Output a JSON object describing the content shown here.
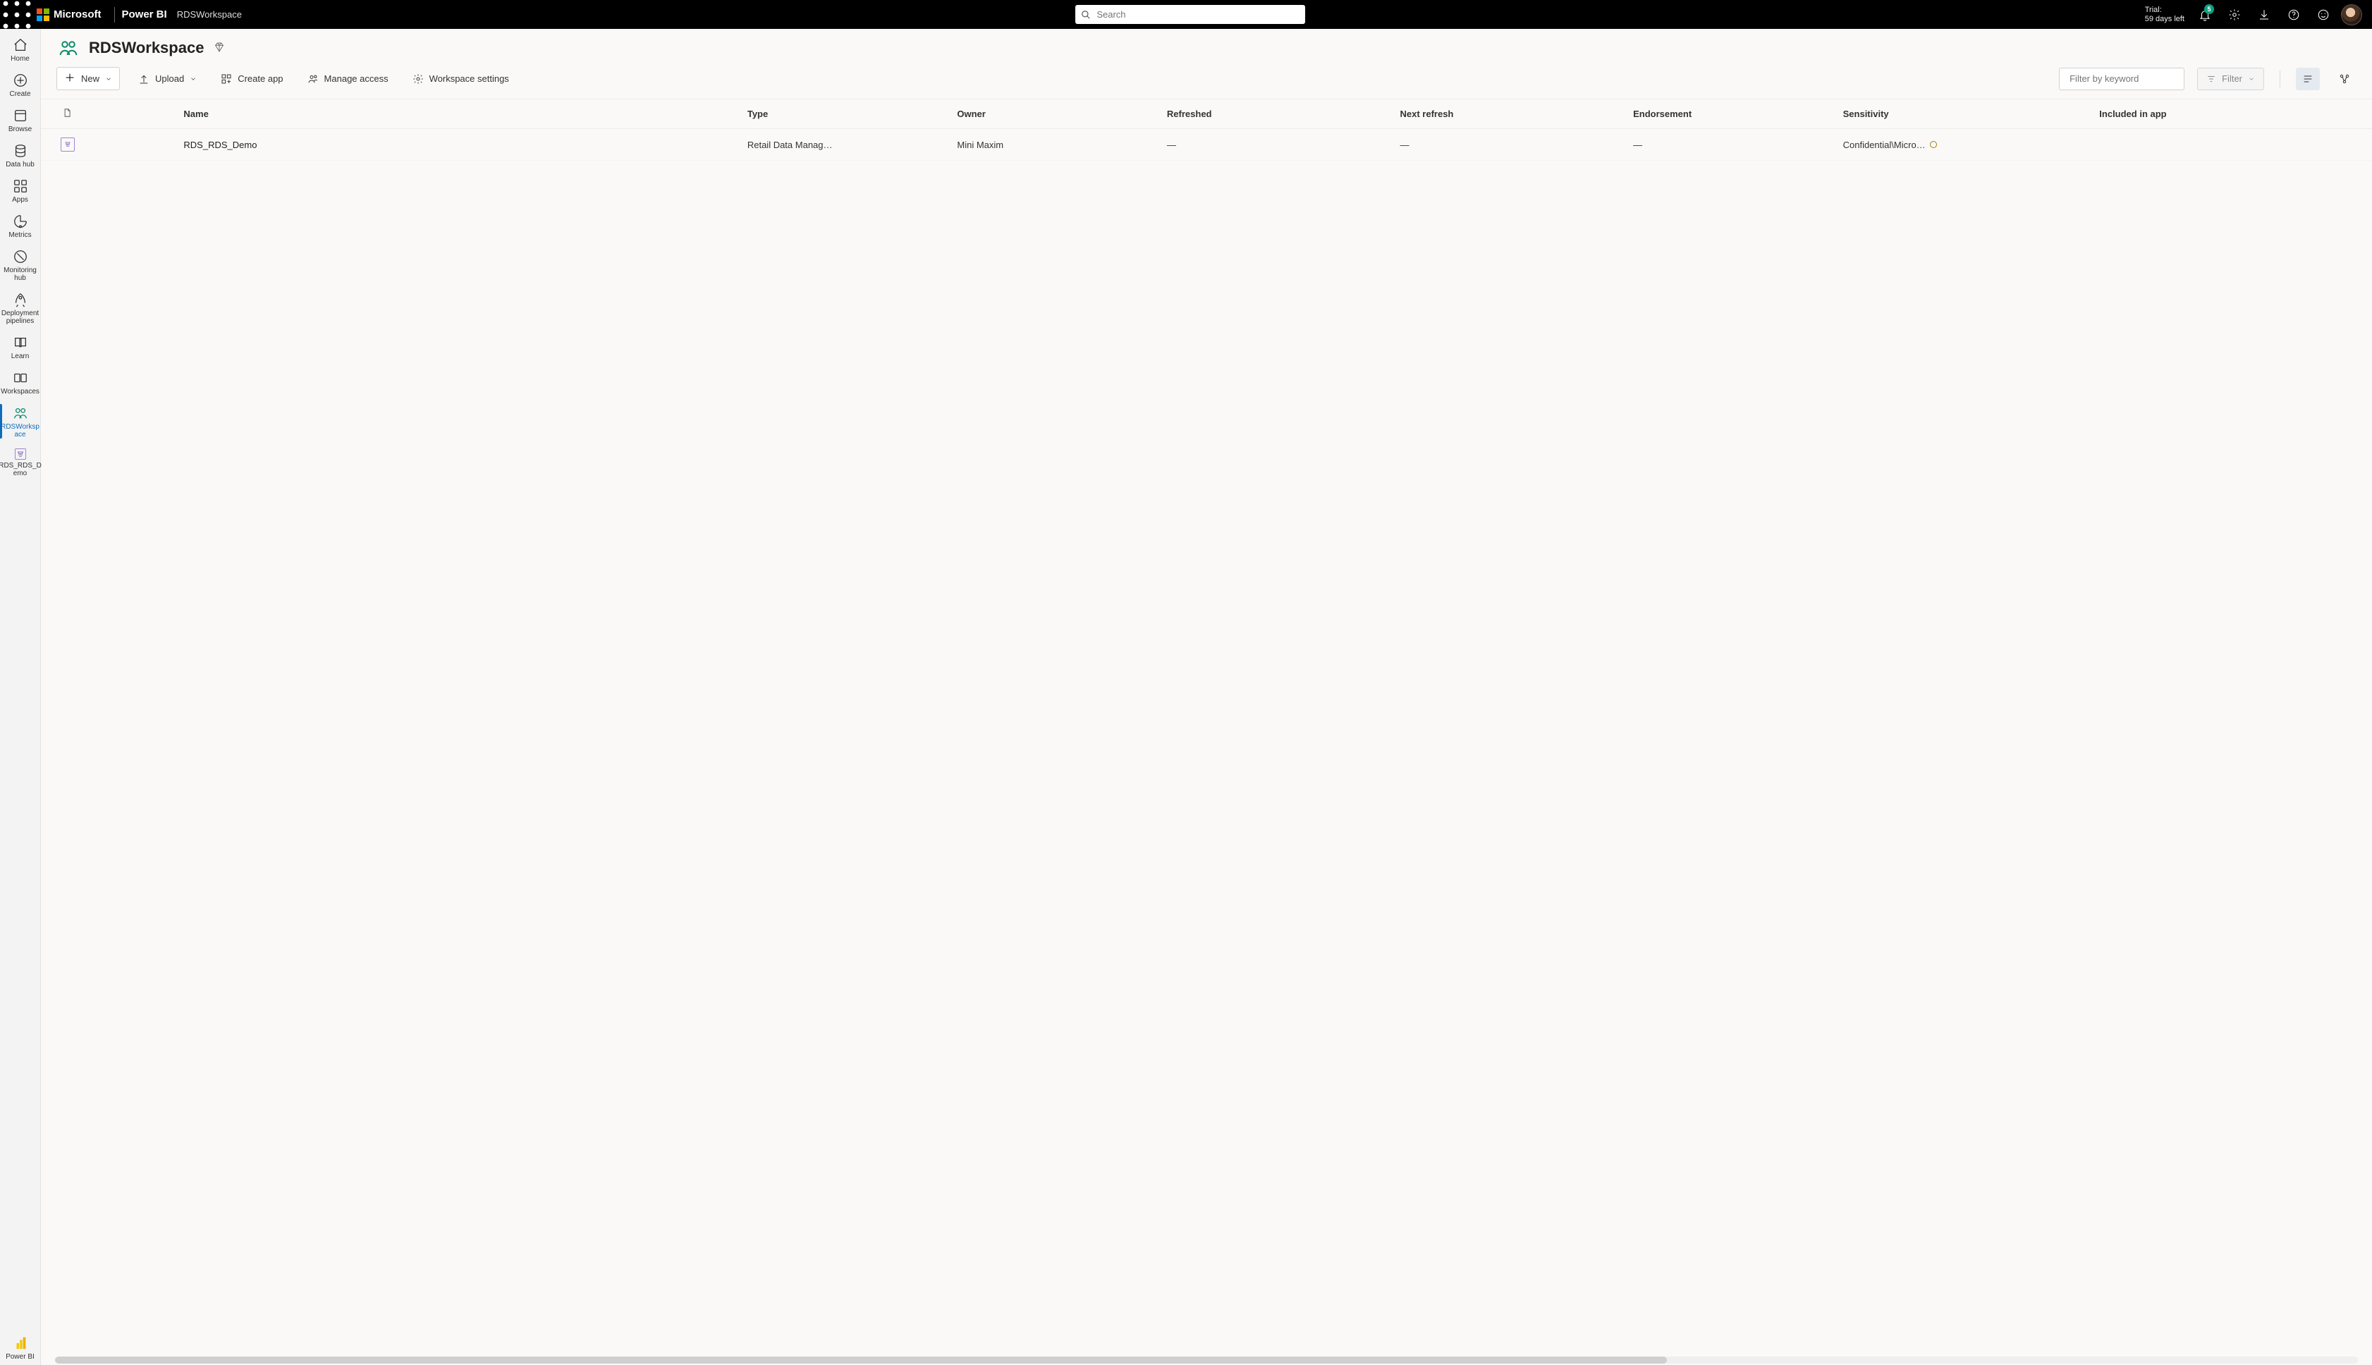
{
  "topbar": {
    "company": "Microsoft",
    "product": "Power BI",
    "breadcrumb": "RDSWorkspace",
    "search_placeholder": "Search",
    "trial_line1": "Trial:",
    "trial_line2": "59 days left",
    "notif_count": "5"
  },
  "leftnav": [
    {
      "id": "home",
      "label": "Home"
    },
    {
      "id": "create",
      "label": "Create"
    },
    {
      "id": "browse",
      "label": "Browse"
    },
    {
      "id": "datahub",
      "label": "Data hub"
    },
    {
      "id": "apps",
      "label": "Apps"
    },
    {
      "id": "metrics",
      "label": "Metrics"
    },
    {
      "id": "monitoring",
      "label": "Monitoring hub"
    },
    {
      "id": "deploy",
      "label": "Deployment pipelines"
    },
    {
      "id": "learn",
      "label": "Learn"
    },
    {
      "id": "workspaces",
      "label": "Workspaces"
    },
    {
      "id": "rdsws",
      "label": "RDSWorksp ace",
      "active": true
    },
    {
      "id": "rdsdemo",
      "label": "RDS_RDS_D emo"
    }
  ],
  "leftnav_footer": {
    "label": "Power BI"
  },
  "page": {
    "title": "RDSWorkspace"
  },
  "toolbar": {
    "new": "New",
    "upload": "Upload",
    "create_app": "Create app",
    "manage_access": "Manage access",
    "ws_settings": "Workspace settings",
    "filter_placeholder": "Filter by keyword",
    "filter_btn": "Filter"
  },
  "table": {
    "columns": {
      "name": "Name",
      "type": "Type",
      "owner": "Owner",
      "refreshed": "Refreshed",
      "next_refresh": "Next refresh",
      "endorsement": "Endorsement",
      "sensitivity": "Sensitivity",
      "included": "Included in app"
    },
    "rows": [
      {
        "name": "RDS_RDS_Demo",
        "type": "Retail Data Manag…",
        "owner": "Mini Maxim",
        "refreshed": "—",
        "next_refresh": "—",
        "endorsement": "—",
        "sensitivity": "Confidential\\Micro…",
        "included": ""
      }
    ]
  }
}
